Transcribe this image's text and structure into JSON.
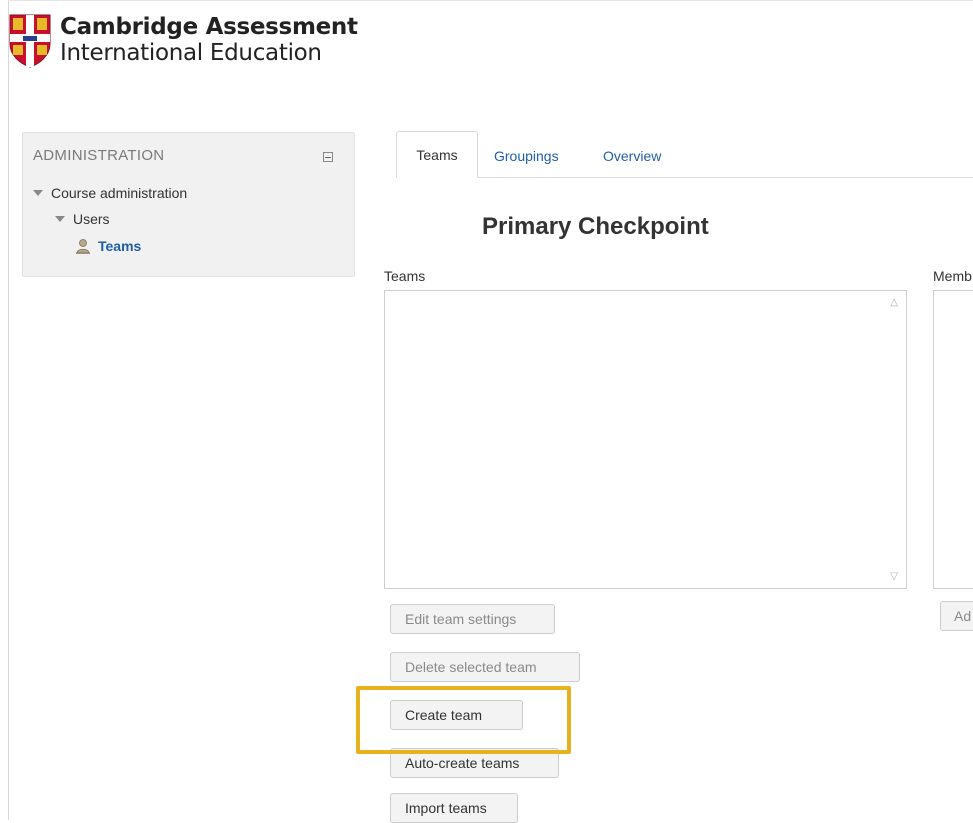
{
  "logo": {
    "line1": "Cambridge Assessment",
    "line2": "International Education",
    "shield_colors": {
      "field": "#c8102e",
      "cross": "#ffffff",
      "accent": "#e8b928"
    }
  },
  "sidebar": {
    "title": "ADMINISTRATION",
    "collapse_icon": "minus-square-icon",
    "tree": [
      {
        "label": "Course administration",
        "icon": "triangle-down-icon"
      },
      {
        "label": "Users",
        "icon": "triangle-down-icon"
      },
      {
        "label": "Teams",
        "icon": "user-icon",
        "active": true
      }
    ]
  },
  "tabs": [
    {
      "label": "Teams",
      "active": true
    },
    {
      "label": "Groupings",
      "active": false
    },
    {
      "label": "Overview",
      "active": false
    }
  ],
  "page_title": "Primary Checkpoint",
  "teams_panel": {
    "label": "Teams",
    "items": [],
    "buttons": {
      "edit": "Edit team settings",
      "delete": "Delete selected team",
      "create": "Create team",
      "auto_create": "Auto-create teams",
      "import": "Import teams"
    }
  },
  "members_panel": {
    "label": "Memb",
    "button": "Ad"
  },
  "highlight_color": "#e6b31e",
  "link_color": "#1f5fa8"
}
